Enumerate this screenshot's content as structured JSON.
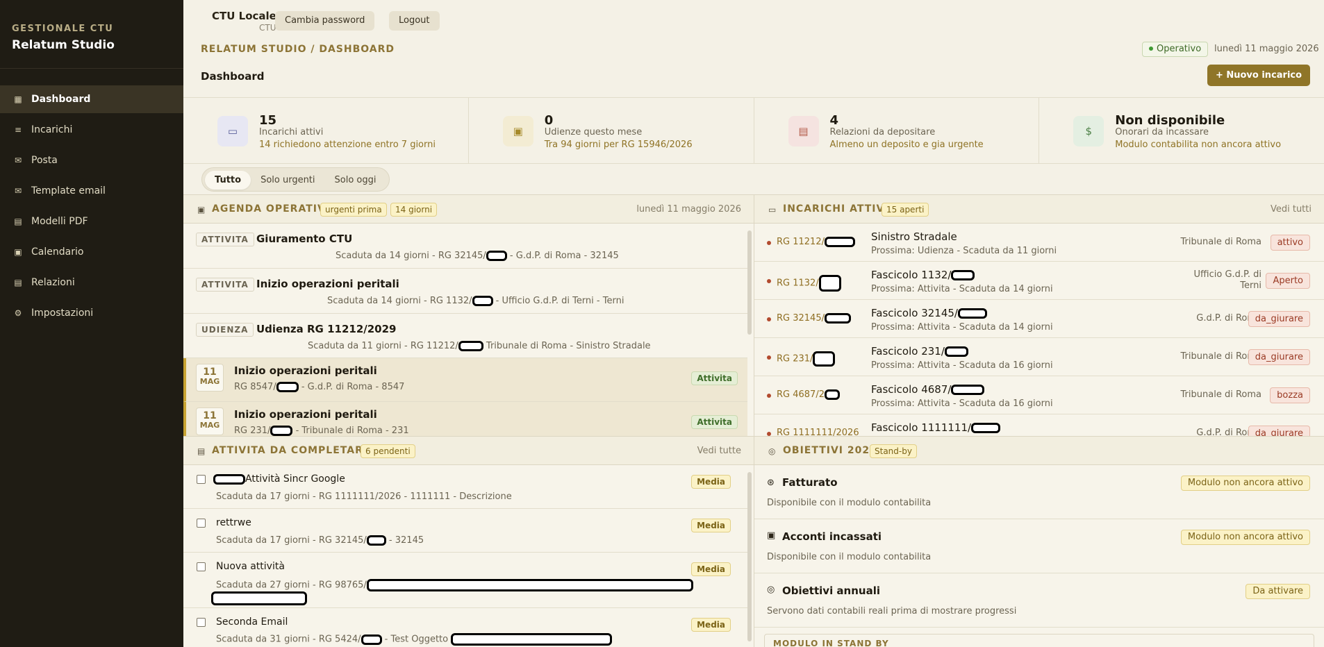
{
  "sidebar": {
    "brand_sub": "GESTIONALE CTU",
    "brand_title": "Relatum Studio",
    "items": [
      {
        "label": "Dashboard",
        "icon": "grid-icon"
      },
      {
        "label": "Incarichi",
        "icon": "list-icon"
      },
      {
        "label": "Posta",
        "icon": "mail-icon"
      },
      {
        "label": "Template email",
        "icon": "mail-icon"
      },
      {
        "label": "Modelli PDF",
        "icon": "document-icon"
      },
      {
        "label": "Calendario",
        "icon": "calendar-icon"
      },
      {
        "label": "Relazioni",
        "icon": "document-icon"
      },
      {
        "label": "Impostazioni",
        "icon": "gear-icon"
      }
    ]
  },
  "topbar": {
    "user_name": "CTU Locale",
    "user_role": "CTU",
    "change_password": "Cambia password",
    "logout": "Logout"
  },
  "header": {
    "breadcrumb": "RELATUM STUDIO / DASHBOARD",
    "status": "Operativo",
    "date": "lunedì 11 maggio 2026",
    "title": "Dashboard",
    "new_button": "+  Nuovo incarico"
  },
  "kpis": [
    {
      "value": "15",
      "label": "Incarichi attivi",
      "note": "14 richiedono attenzione entro 7 giorni"
    },
    {
      "value": "0",
      "label": "Udienze questo mese",
      "note": "Tra 94 giorni per RG 15946/2026"
    },
    {
      "value": "4",
      "label": "Relazioni da depositare",
      "note": "Almeno un deposito e gia urgente"
    },
    {
      "value": "Non disponibile",
      "label": "Onorari da incassare",
      "note": "Modulo contabilita non ancora attivo"
    }
  ],
  "filters": [
    "Tutto",
    "Solo urgenti",
    "Solo oggi"
  ],
  "agenda": {
    "title": "AGENDA OPERATIVA",
    "badge1": "urgenti prima",
    "badge2": "14 giorni",
    "date": "lunedì 11 maggio 2026",
    "rows": [
      {
        "tag": "ATTIVITA",
        "title": "Giuramento CTU",
        "meta_a": "Scaduta da 14 giorni - RG 32145/",
        "meta_b": " - G.d.P. di Roma - 32145"
      },
      {
        "tag": "ATTIVITA",
        "title": "Inizio operazioni peritali",
        "meta_a": "Scaduta da 14 giorni - RG 1132/",
        "meta_b": " - Ufficio G.d.P. di Terni - Terni"
      },
      {
        "tag": "UDIENZA",
        "title": "Udienza RG 11212/2029",
        "meta_a": "Scaduta da 11 giorni - RG 11212/",
        "meta_b": " Tribunale di Roma - Sinistro Stradale"
      }
    ],
    "dated": [
      {
        "day": "11",
        "month": "MAG",
        "title": "Inizio operazioni peritali",
        "meta_a": "RG 8547/",
        "meta_b": " - G.d.P. di Roma - 8547",
        "type": "Attivita"
      },
      {
        "day": "11",
        "month": "MAG",
        "title": "Inizio operazioni peritali",
        "meta_a": "RG 231/",
        "meta_b": " - Tribunale di Roma - 231",
        "type": "Attivita"
      }
    ]
  },
  "incarichi": {
    "title": "INCARICHI ATTIVI",
    "badge": "15 aperti",
    "link": "Vedi tutti",
    "rows": [
      {
        "rg": "RG 11212/",
        "title": "Sinistro Stradale",
        "next": "Prossima: Udienza - Scaduta da 11 giorni",
        "court": "Tribunale di Roma",
        "state": "attivo"
      },
      {
        "rg": "RG 1132/",
        "title": "Fascicolo 1132/",
        "next": "Prossima: Attivita - Scaduta da 14 giorni",
        "court": "Ufficio G.d.P. di Terni",
        "state": "Aperto"
      },
      {
        "rg": "RG 32145/",
        "title": "Fascicolo 32145/",
        "next": "Prossima: Attivita - Scaduta da 14 giorni",
        "court": "G.d.P. di Roma",
        "state": "da_giurare"
      },
      {
        "rg": "RG 231/",
        "title": "Fascicolo 231/",
        "next": "Prossima: Attivita - Scaduta da 16 giorni",
        "court": "Tribunale di Roma",
        "state": "da_giurare"
      },
      {
        "rg": "RG 4687/2",
        "title": "Fascicolo 4687/",
        "next": "Prossima: Attivita - Scaduta da 16 giorni",
        "court": "Tribunale di Roma",
        "state": "bozza"
      },
      {
        "rg": "RG 1111111/2026",
        "title": "Fascicolo 1111111/",
        "next": "",
        "court": "G.d.P. di Roma",
        "state": "da_giurare"
      }
    ]
  },
  "attivita": {
    "title": "ATTIVITA DA COMPLETARE",
    "badge": "6 pendenti",
    "link": "Vedi tutte",
    "rows": [
      {
        "title": "Attività Sincr Google",
        "meta": "Scaduta da 17 giorni - RG 1111111/2026 - 1111111 - Descrizione",
        "prio": "Media"
      },
      {
        "title": "rettrwe",
        "meta": "Scaduta da 17 giorni - RG 32145/",
        "meta_b": " - 32145",
        "prio": "Media"
      },
      {
        "title": "Nuova attività",
        "meta": "Scaduta da 27 giorni - RG 98765/",
        "prio": "Media"
      },
      {
        "title": "Seconda Email",
        "meta": "Scaduta da 31 giorni - RG 5424/",
        "meta_b": " - Test Oggetto",
        "prio": "Media"
      }
    ]
  },
  "obiettivi": {
    "title": "OBIETTIVI 2026",
    "badge": "Stand-by",
    "rows": [
      {
        "icon": "coin-icon",
        "title": "Fatturato",
        "desc": "Disponibile con il modulo contabilita",
        "badge": "Modulo non ancora attivo"
      },
      {
        "icon": "calendar-icon",
        "title": "Acconti incassati",
        "desc": "Disponibile con il modulo contabilita",
        "badge": "Modulo non ancora attivo"
      },
      {
        "icon": "target-icon",
        "title": "Obiettivi annuali",
        "desc": "Servono dati contabili reali prima di mostrare progressi",
        "badge": "Da attivare"
      }
    ],
    "footer": "MODULO IN STAND BY"
  }
}
